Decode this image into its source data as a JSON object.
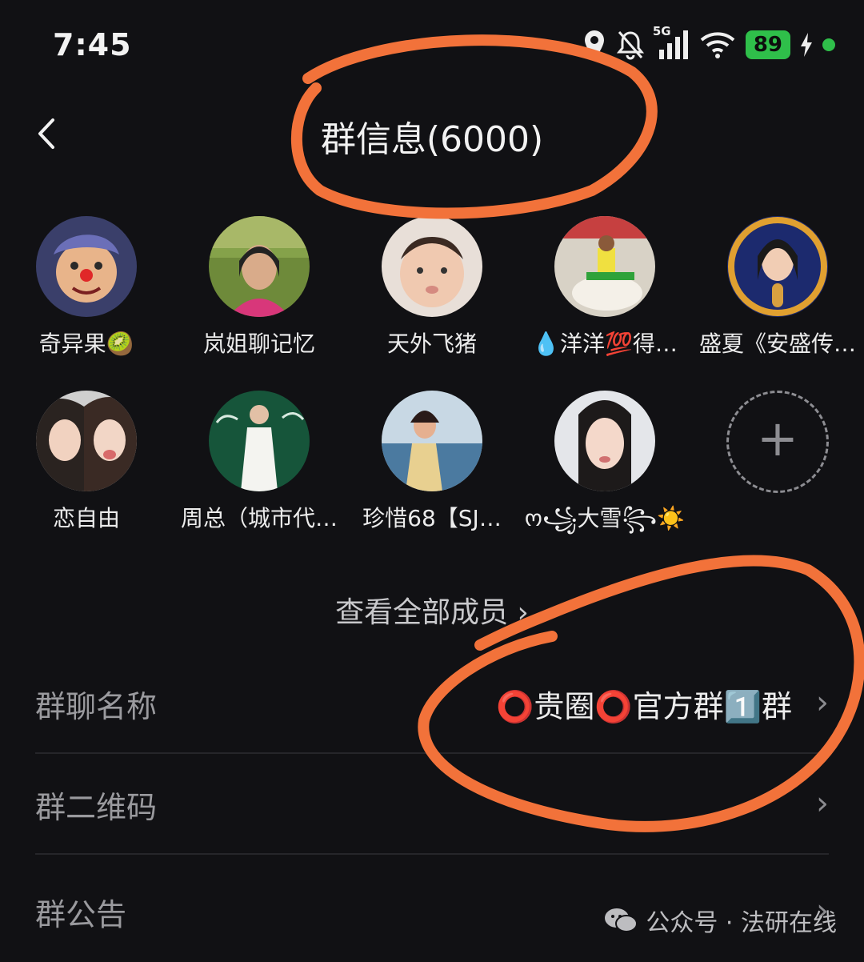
{
  "status_bar": {
    "time": "7:45",
    "network": "5G",
    "battery": "89"
  },
  "header": {
    "title": "群信息(6000)"
  },
  "members": [
    {
      "name": "奇异果🥝"
    },
    {
      "name": "岚姐聊记忆"
    },
    {
      "name": "天外飞猪"
    },
    {
      "name": "💧洋洋💯得…"
    },
    {
      "name": "盛夏《安盛传…"
    },
    {
      "name": "恋自由"
    },
    {
      "name": "周总（城市代…"
    },
    {
      "name": "珍惜68【SJ…"
    },
    {
      "name": "ო꧁大雪꧂☀️"
    }
  ],
  "add_member": {
    "icon": "+"
  },
  "view_all": {
    "label": "查看全部成员 ›"
  },
  "settings": [
    {
      "label": "群聊名称",
      "value": "⭕贵圈⭕官方群1️⃣群"
    },
    {
      "label": "群二维码",
      "value": ""
    },
    {
      "label": "群公告",
      "value": ""
    }
  ],
  "watermark": {
    "text": "公众号 · 法研在线"
  },
  "colors": {
    "background": "#111114",
    "annotation": "#f2723a",
    "battery": "#2fbf4a"
  }
}
